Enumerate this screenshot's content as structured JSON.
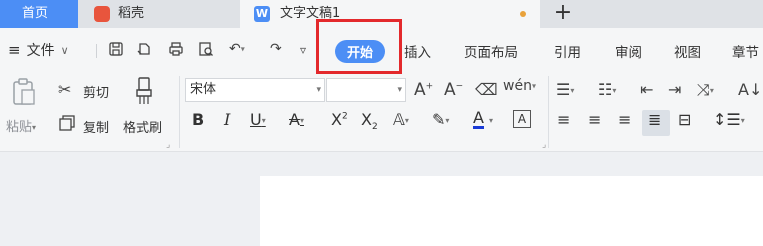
{
  "tabs": {
    "home": "首页",
    "daoke": "稻壳",
    "doc": "文字文稿1",
    "doc_logo": "W",
    "add": "+"
  },
  "menu": {
    "file": "文件",
    "ribbon_tabs": [
      "开始",
      "插入",
      "页面布局",
      "引用",
      "审阅",
      "视图",
      "章节"
    ]
  },
  "ribbon": {
    "paste": "粘贴",
    "cut": "剪切",
    "copy": "复制",
    "format_painter": "格式刷",
    "font_name": "宋体",
    "font_size": ""
  },
  "colors": {
    "accent": "#4c8ef5",
    "highlight": "#e3292c",
    "unsaved": "#e9a23b"
  }
}
